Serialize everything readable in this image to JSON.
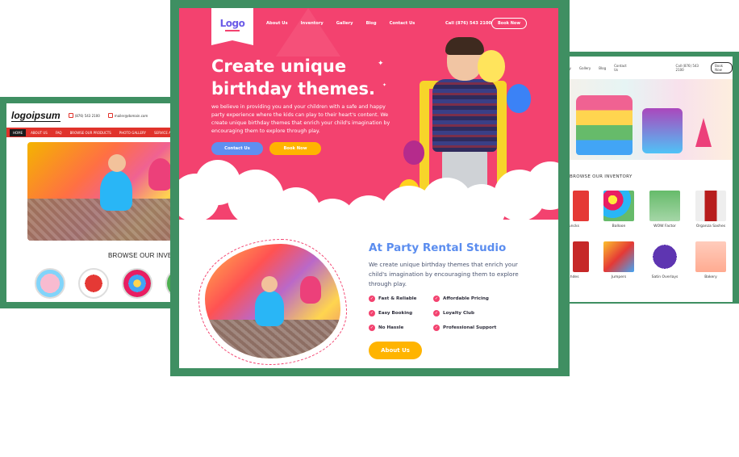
{
  "left_mockup": {
    "logo": "logoipsum",
    "phone": "(876) 543 2100",
    "email": "mailer@domain.com",
    "nav": [
      "HOME",
      "ABOUT US",
      "FAQ",
      "BROWSE OUR PRODUCTS",
      "PHOTO GALLERY",
      "SERVICE AR"
    ],
    "browse_heading": "BROWSE OUR INVENTORY"
  },
  "right_mockup": {
    "nav": [
      "ry",
      "Gallery",
      "Blog",
      "Contact Us"
    ],
    "phone": "Call (876) 543 2100",
    "book_label": "Book Now",
    "browse_heading": "BROWSE OUR INVENTORY",
    "items": [
      {
        "caption": "ouncks",
        "color": "#e53935"
      },
      {
        "caption": "Balloon",
        "color": "#29b6f6"
      },
      {
        "caption": "WOW Factor",
        "color": "#66bb6a"
      },
      {
        "caption": "Organza Sashes",
        "color": "#b71c1c"
      },
      {
        "caption": "...hdes",
        "color": "#c62828"
      },
      {
        "caption": "Jumpers",
        "color": "#fbc02d"
      },
      {
        "caption": "Satin Overlays",
        "color": "#5e35b1"
      },
      {
        "caption": "Bakery",
        "color": "#ffab91"
      }
    ]
  },
  "main": {
    "logo": "Logo",
    "nav": [
      "About Us",
      "Inventory",
      "Gallery",
      "Blog",
      "Contact Us"
    ],
    "phone": "Call (876) 543 2100",
    "book_now_top": "Book Now",
    "hero_title": "Create unique birthday themes.",
    "hero_text": "we believe in providing you and your children with a safe and happy party experience where the kids can play to their heart's content. We create unique birthday themes that enrich your child's imagination by encouraging them to explore through play.",
    "btn_contact": "Contact Us",
    "btn_book": "Book Now",
    "about_title": "At Party Rental Studio",
    "about_text": "We create unique birthday themes that enrich your child's imagination by encouraging them to explore through play.",
    "features": [
      "Fast & Reliable",
      "Affordable Pricing",
      "Easy Booking",
      "Loyalty Club",
      "No Hassle",
      "Professional Support"
    ],
    "btn_about": "About Us",
    "colors": {
      "brand_pink": "#f3426f",
      "accent_yellow": "#ffb400",
      "accent_blue": "#5e8ff0",
      "frame_green": "#3f8f62"
    }
  }
}
